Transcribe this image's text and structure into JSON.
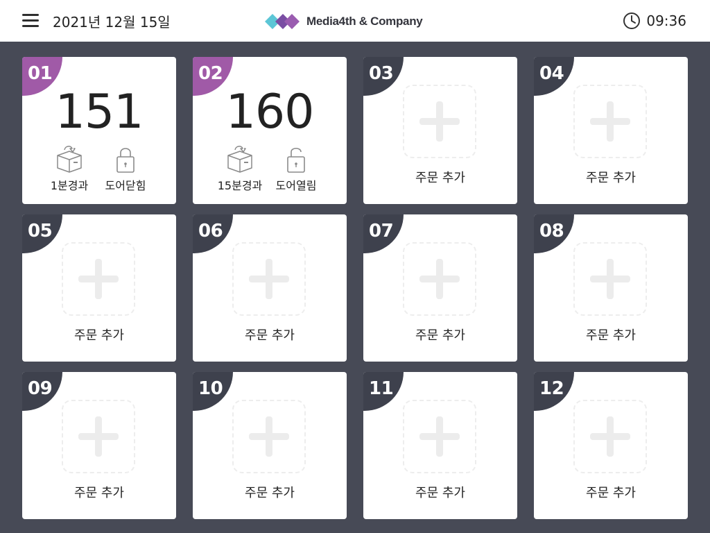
{
  "header": {
    "date": "2021년 12월 15일",
    "brand": "Media4th & Company",
    "time": "09:36",
    "icons": [
      "menu-icon",
      "logo-icon",
      "clock-icon"
    ]
  },
  "colors": {
    "background": "#474a56",
    "active_badge": "#a05aa7",
    "idle_badge": "#3e414d",
    "logo_cyan": "#5cc6d6",
    "logo_purple": "#7a4ea3"
  },
  "slots": [
    {
      "number": "01",
      "active": true,
      "count": "151",
      "elapsed": "1분경과",
      "door": "도어닫힘",
      "door_state": "closed"
    },
    {
      "number": "02",
      "active": true,
      "count": "160",
      "elapsed": "15분경과",
      "door": "도어열림",
      "door_state": "open"
    },
    {
      "number": "03",
      "active": false,
      "add_label": "주문 추가"
    },
    {
      "number": "04",
      "active": false,
      "add_label": "주문 추가"
    },
    {
      "number": "05",
      "active": false,
      "add_label": "주문 추가"
    },
    {
      "number": "06",
      "active": false,
      "add_label": "주문 추가"
    },
    {
      "number": "07",
      "active": false,
      "add_label": "주문 추가"
    },
    {
      "number": "08",
      "active": false,
      "add_label": "주문 추가"
    },
    {
      "number": "09",
      "active": false,
      "add_label": "주문 추가"
    },
    {
      "number": "10",
      "active": false,
      "add_label": "주문 추가"
    },
    {
      "number": "11",
      "active": false,
      "add_label": "주문 추가"
    },
    {
      "number": "12",
      "active": false,
      "add_label": "주문 추가"
    }
  ]
}
